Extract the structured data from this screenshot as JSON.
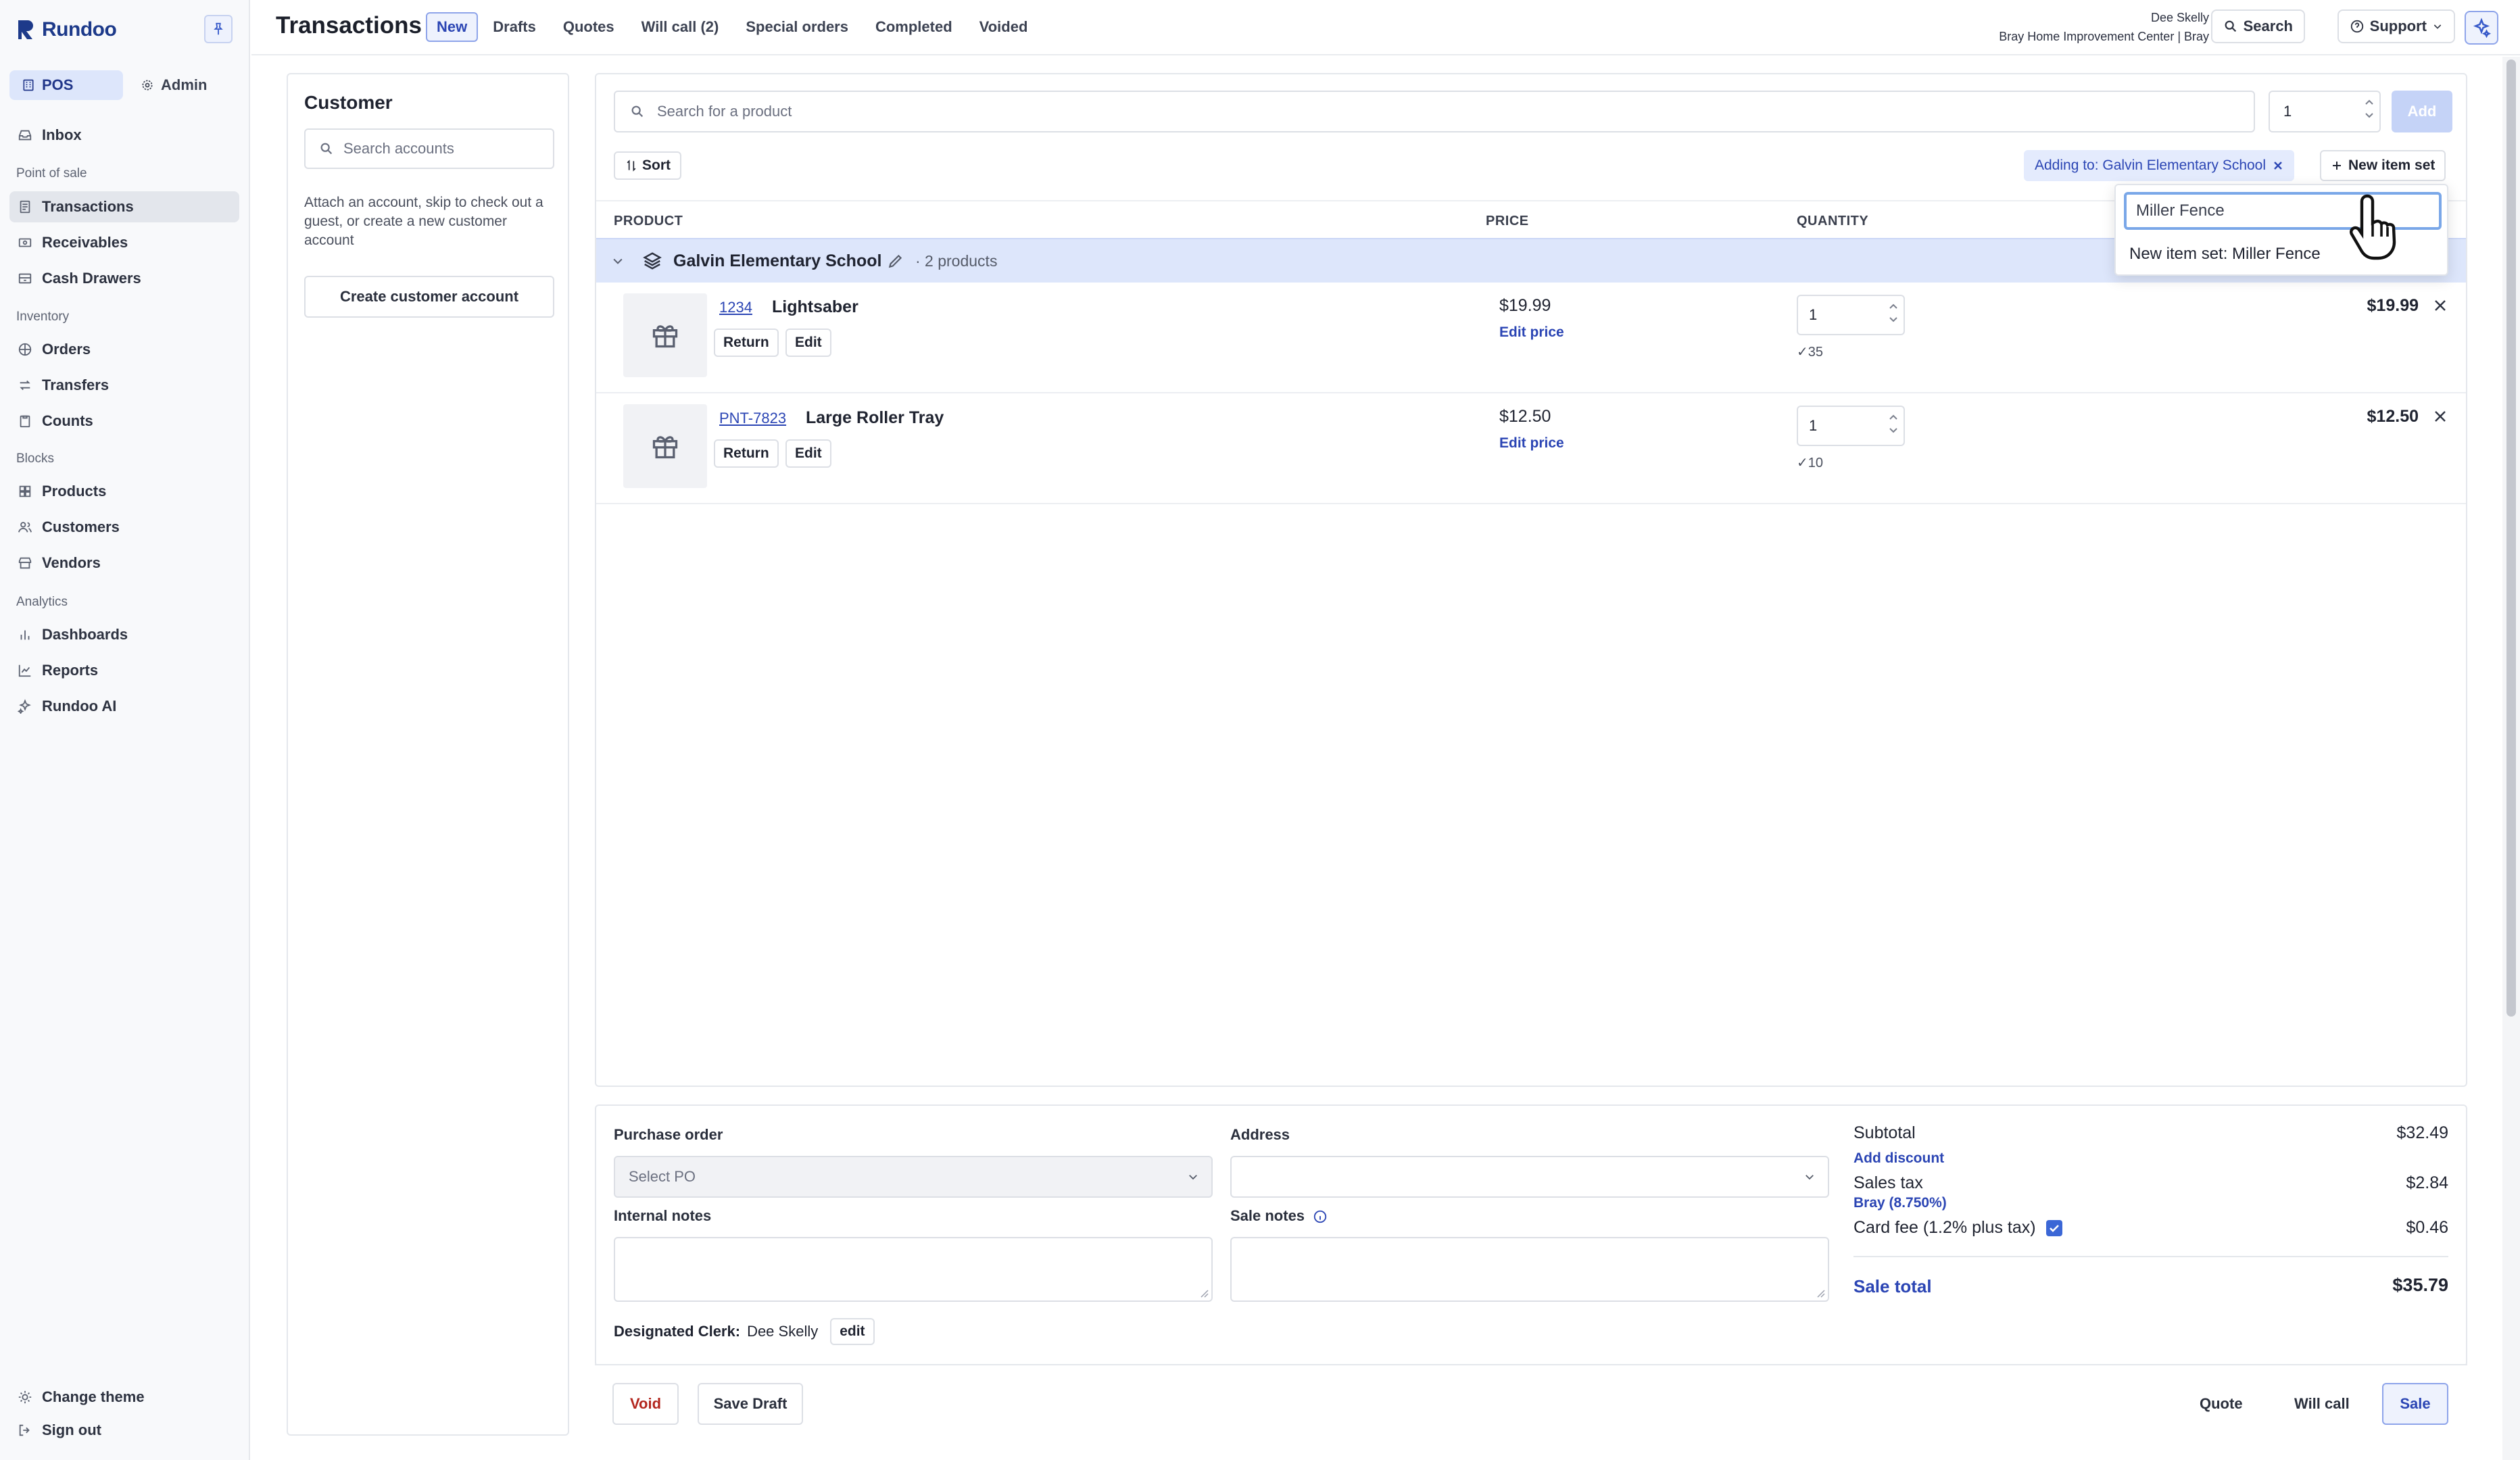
{
  "app": {
    "logo_text": "Rundoo",
    "mode_tabs": [
      "POS",
      "Admin"
    ]
  },
  "sidebar": {
    "inbox": "Inbox",
    "sections": {
      "pos": "Point of sale",
      "inventory": "Inventory",
      "blocks": "Blocks",
      "analytics": "Analytics"
    },
    "items": {
      "transactions": "Transactions",
      "receivables": "Receivables",
      "cash_drawers": "Cash Drawers",
      "orders": "Orders",
      "transfers": "Transfers",
      "counts": "Counts",
      "products": "Products",
      "customers": "Customers",
      "vendors": "Vendors",
      "dashboards": "Dashboards",
      "reports": "Reports",
      "rundoo_ai": "Rundoo AI",
      "change_theme": "Change theme",
      "sign_out": "Sign out"
    }
  },
  "header": {
    "title": "Transactions",
    "tabs": [
      "New",
      "Drafts",
      "Quotes",
      "Will call (2)",
      "Special orders",
      "Completed",
      "Voided"
    ],
    "active_tab": "New",
    "user_name": "Dee Skelly",
    "user_location": "Bray Home Improvement Center | Bray",
    "search_label": "Search",
    "support_label": "Support"
  },
  "customer": {
    "title": "Customer",
    "search_placeholder": "Search accounts",
    "help_text": "Attach an account, skip to check out a guest, or create a new customer account",
    "create_label": "Create customer account"
  },
  "products": {
    "search_placeholder": "Search for a product",
    "add_qty": "1",
    "add_label": "Add",
    "sort_label": "Sort",
    "adding_to": "Adding to: Galvin Elementary School",
    "new_item_set_label": "New item set",
    "columns": [
      "PRODUCT",
      "PRICE",
      "QUANTITY"
    ],
    "group": {
      "name": "Galvin Elementary School",
      "count": "· 2 products"
    },
    "items": [
      {
        "sku": "1234",
        "name": "Lightsaber",
        "price": "$19.99",
        "edit_price": "Edit price",
        "qty": "1",
        "stock": "35",
        "total": "$19.99",
        "return_label": "Return",
        "edit_label": "Edit"
      },
      {
        "sku": "PNT-7823",
        "name": "Large Roller Tray",
        "price": "$12.50",
        "edit_price": "Edit price",
        "qty": "1",
        "stock": "10",
        "total": "$12.50",
        "return_label": "Return",
        "edit_label": "Edit"
      }
    ]
  },
  "item_set_dropdown": {
    "input_value": "Miller Fence",
    "option": "New item set: Miller Fence"
  },
  "footer": {
    "purchase_order_label": "Purchase order",
    "purchase_order_placeholder": "Select PO",
    "address_label": "Address",
    "internal_notes_label": "Internal notes",
    "sale_notes_label": "Sale notes",
    "designated_clerk_label": "Designated Clerk:",
    "designated_clerk_name": "Dee Skelly",
    "clerk_edit": "edit",
    "subtotal_label": "Subtotal",
    "subtotal_value": "$32.49",
    "add_discount": "Add discount",
    "sales_tax_label": "Sales tax",
    "sales_tax_value": "$2.84",
    "tax_region": "Bray (8.750%)",
    "card_fee_label": "Card fee (1.2% plus tax)",
    "card_fee_value": "$0.46",
    "sale_total_label": "Sale total",
    "sale_total_value": "$35.79"
  },
  "actions": {
    "void": "Void",
    "save_draft": "Save Draft",
    "quote": "Quote",
    "will_call": "Will call",
    "sale": "Sale"
  }
}
